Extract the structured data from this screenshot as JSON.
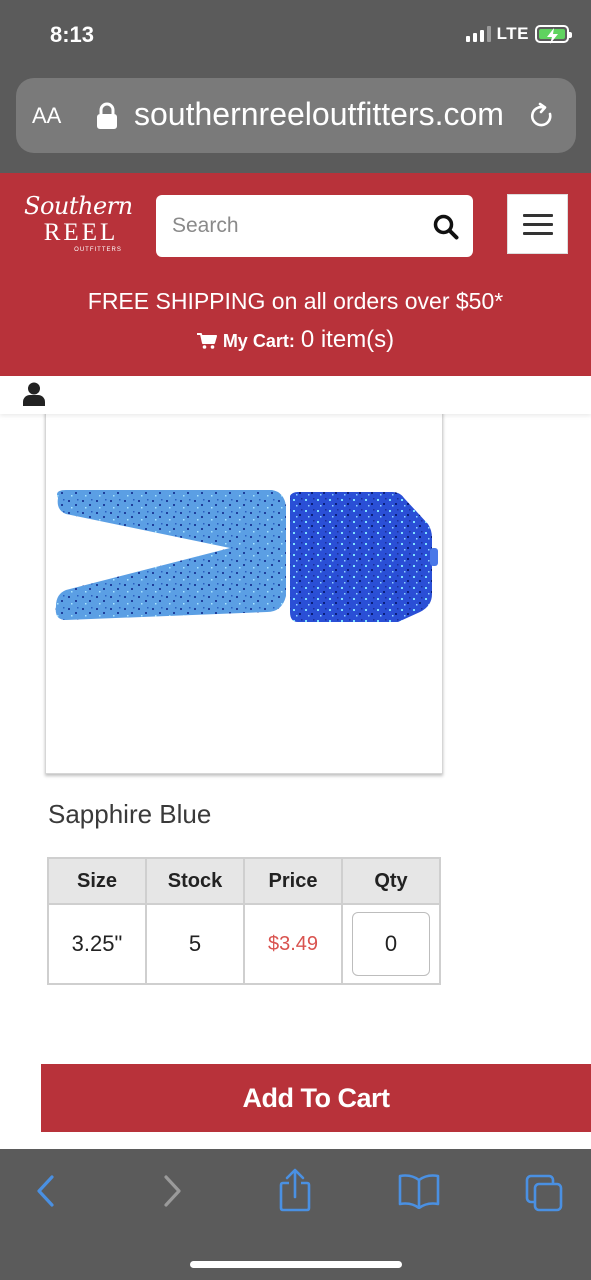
{
  "status_bar": {
    "time": "8:13",
    "network": "LTE",
    "battery_color": "#5fd35f"
  },
  "browser": {
    "aa_label": "AA",
    "url": "southernreeloutfitters.com",
    "lock_icon": "lock-icon",
    "reload_icon": "reload-icon"
  },
  "header": {
    "brand_color": "#b8323a",
    "logo": {
      "script": "Southern",
      "main": "REEL",
      "sub": "OUTFITTERS"
    },
    "search": {
      "placeholder": "Search",
      "value": ""
    },
    "menu_icon": "hamburger-icon",
    "shipping_text": "FREE SHIPPING on all orders over $50*",
    "cart": {
      "label": "My Cart:",
      "count": "0 item(s)"
    }
  },
  "user_icon": "user-icon",
  "product": {
    "name": "Sapphire Blue",
    "colors": {
      "tail": "#5b9fe4",
      "head": "#2a4fd6"
    },
    "table": {
      "headers": [
        "Size",
        "Stock",
        "Price",
        "Qty"
      ],
      "rows": [
        {
          "size": "3.25\"",
          "stock": "5",
          "price": "$3.49",
          "qty": "0"
        }
      ]
    },
    "add_to_cart": "Add To Cart"
  },
  "safari_toolbar": {
    "icons": [
      "back-icon",
      "forward-icon",
      "share-icon",
      "bookmarks-icon",
      "tabs-icon"
    ],
    "active_color": "#4a90e2",
    "disabled_color": "#9a9a9a"
  }
}
